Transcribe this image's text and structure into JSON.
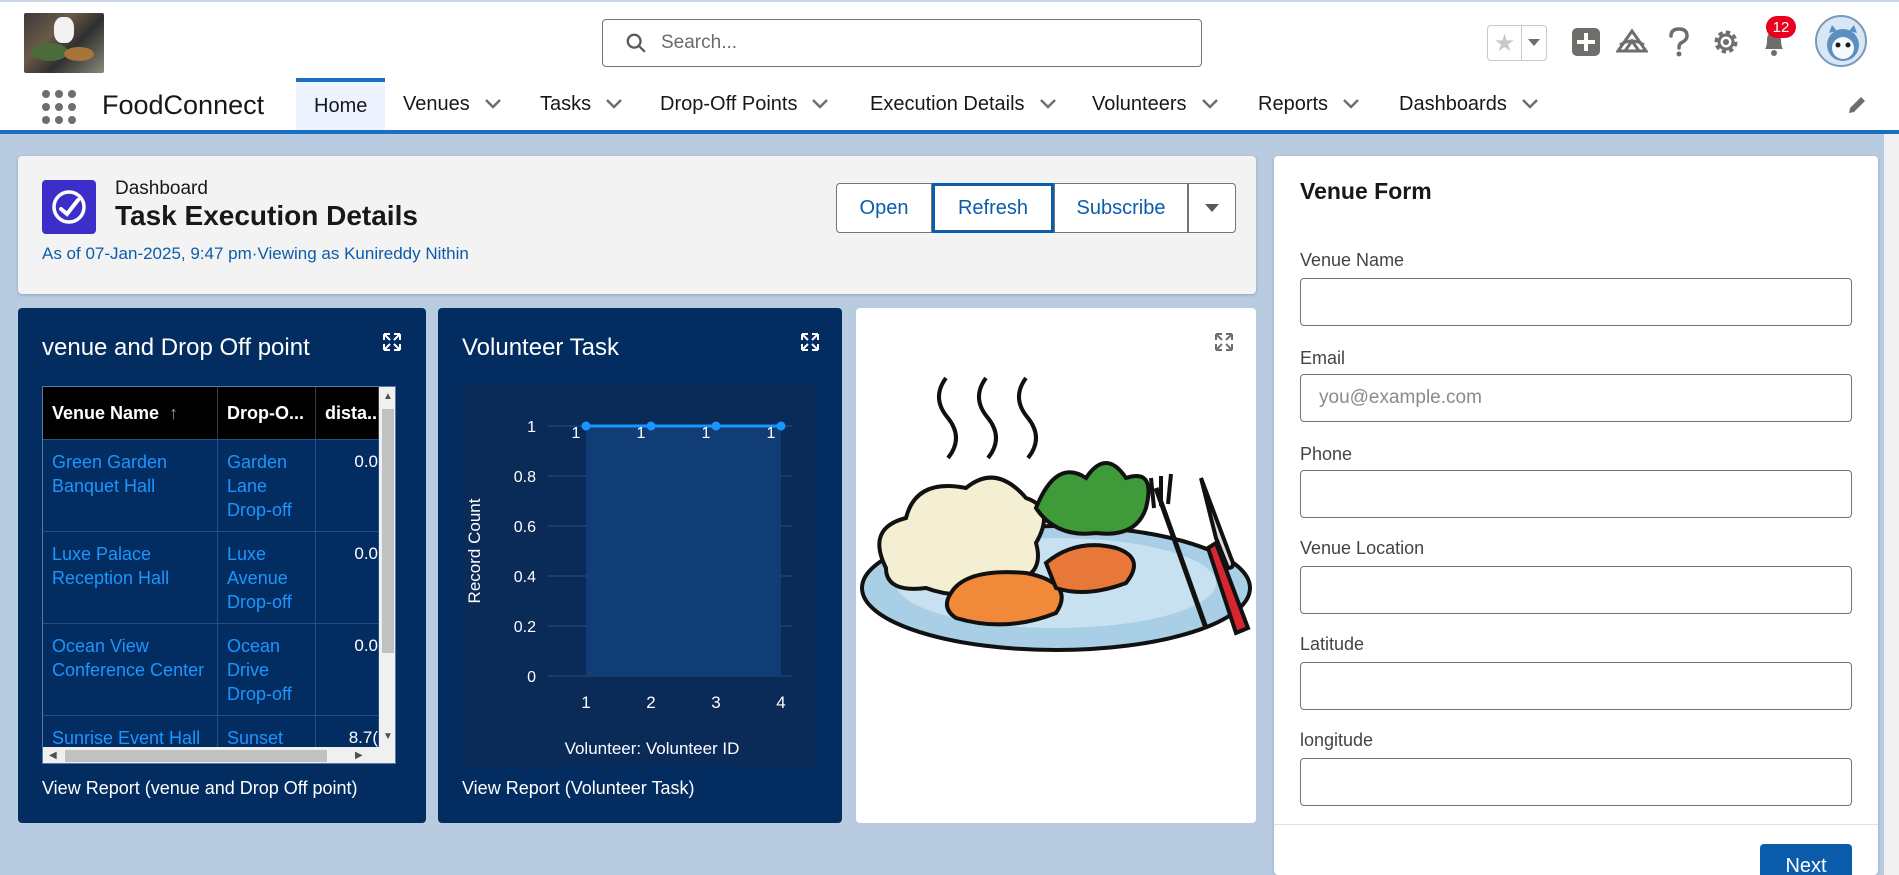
{
  "header": {
    "search_placeholder": "Search...",
    "notification_count": "12"
  },
  "nav": {
    "app_name": "FoodConnect",
    "items": [
      {
        "label": "Home",
        "active": true
      },
      {
        "label": "Venues"
      },
      {
        "label": "Tasks"
      },
      {
        "label": "Drop-Off Points"
      },
      {
        "label": "Execution Details"
      },
      {
        "label": "Volunteers"
      },
      {
        "label": "Reports"
      },
      {
        "label": "Dashboards"
      }
    ]
  },
  "dashboard": {
    "type_label": "Dashboard",
    "title": "Task Execution Details",
    "meta": "As of 07-Jan-2025, 9:47 pm·Viewing as Kunireddy Nithin",
    "buttons": {
      "open": "Open",
      "refresh": "Refresh",
      "subscribe": "Subscribe"
    }
  },
  "widget1": {
    "title": "venue and Drop Off point",
    "columns": [
      "Venue Name",
      "Drop-O...",
      "dista..."
    ],
    "sort_indicator": "↑",
    "rows": [
      {
        "venue": "Green Garden Banquet Hall",
        "dropoff": "Garden Lane Drop-off",
        "distance": "0.0"
      },
      {
        "venue": "Luxe Palace Reception Hall",
        "dropoff": "Luxe Avenue Drop-off",
        "distance": "0.0"
      },
      {
        "venue": "Ocean View Conference Center",
        "dropoff": "Ocean Drive Drop-off",
        "distance": "0.0"
      },
      {
        "venue": "Sunrise Event Hall",
        "dropoff": "Sunset",
        "distance": "8.7("
      }
    ],
    "footer": "View Report (venue and Drop Off point)"
  },
  "widget2": {
    "title": "Volunteer Task",
    "footer": "View Report (Volunteer Task)"
  },
  "chart_data": {
    "type": "line",
    "x": [
      "1",
      "2",
      "3",
      "4"
    ],
    "series": [
      {
        "values": [
          1,
          1,
          1,
          1
        ]
      }
    ],
    "data_labels": [
      "1",
      "1",
      "1",
      "1"
    ],
    "yticks": [
      "0",
      "0.2",
      "0.4",
      "0.6",
      "0.8",
      "1"
    ],
    "ylim": [
      0,
      1
    ],
    "xlabel": "Volunteer: Volunteer ID",
    "ylabel": "Record Count",
    "grid": true,
    "colors": {
      "line": "#1b96ff",
      "area": "#123f7a"
    }
  },
  "form": {
    "title": "Venue Form",
    "fields": [
      {
        "label": "Venue Name",
        "value": "",
        "placeholder": ""
      },
      {
        "label": "Email",
        "value": "",
        "placeholder": "you@example.com"
      },
      {
        "label": "Phone",
        "value": "",
        "placeholder": ""
      },
      {
        "label": "Venue Location",
        "value": "",
        "placeholder": ""
      },
      {
        "label": "Latitude",
        "value": "",
        "placeholder": ""
      },
      {
        "label": "longitude",
        "value": "",
        "placeholder": ""
      }
    ],
    "next_label": "Next"
  },
  "colors": {
    "brand": "#0b5cab",
    "widget_bg": "#032d60",
    "badge": "#ea001e"
  }
}
